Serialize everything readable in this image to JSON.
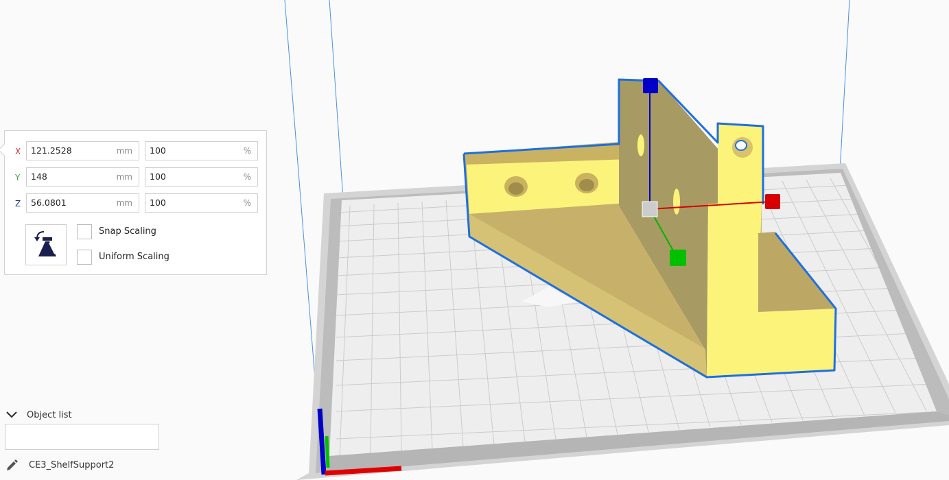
{
  "scale_tool": {
    "rows": [
      {
        "axis": "X",
        "axis_color": "#d32f2f",
        "size_value": "121.2528",
        "size_unit": "mm",
        "percent_value": "100",
        "percent_unit": "%"
      },
      {
        "axis": "Y",
        "axis_color": "#43a047",
        "size_value": "148",
        "size_unit": "mm",
        "percent_value": "100",
        "percent_unit": "%"
      },
      {
        "axis": "Z",
        "axis_color": "#1e3a8a",
        "size_value": "56.0801",
        "size_unit": "mm",
        "percent_value": "100",
        "percent_unit": "%"
      }
    ],
    "lock_icon": "lock-model-icon",
    "snap_scaling_label": "Snap Scaling",
    "snap_scaling_checked": false,
    "uniform_scaling_label": "Uniform Scaling",
    "uniform_scaling_checked": false
  },
  "object_list": {
    "title": "Object list",
    "collapse_icon": "chevron-down-icon",
    "object_name": "CE3_ShelfSupport2",
    "edit_icon": "pencil-icon"
  },
  "colors": {
    "model_top": "#fcf37a",
    "model_side": "#b8a55e",
    "selection_outline": "#1e6fe0",
    "axis_x": "#d60000",
    "axis_y": "#00b300",
    "axis_z": "#0000c8",
    "build_plate": "#e8e8e8",
    "grid_line": "#c9c9c9"
  }
}
